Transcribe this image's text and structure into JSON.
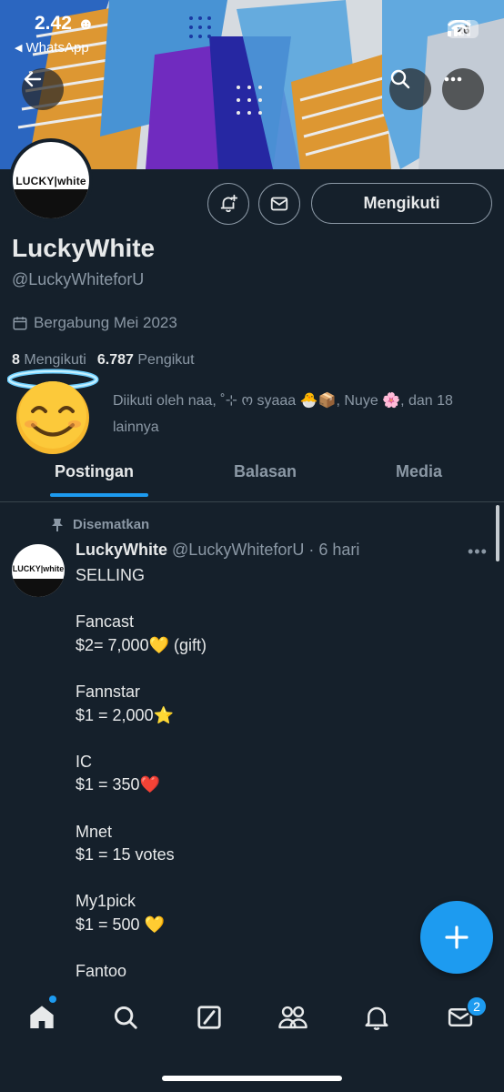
{
  "status_bar": {
    "time": "2.42",
    "back_app": "WhatsApp",
    "battery": "26"
  },
  "profile": {
    "avatar_logo": "LUCKY|white",
    "follow_label": "Mengikuti",
    "display_name": "LuckyWhite",
    "handle": "@LuckyWhiteforU",
    "joined": "Bergabung Mei 2023",
    "following_count": "8",
    "following_label": "Mengikuti",
    "followers_count": "6.787",
    "followers_label": "Pengikut",
    "followed_by": "Diikuti oleh naa, ˚⊹ ო syaaa 🐣📦, Nuye 🌸, dan 18 lainnya"
  },
  "tabs": [
    {
      "label": "Postingan",
      "active": true
    },
    {
      "label": "Balasan",
      "active": false
    },
    {
      "label": "Media",
      "active": false
    }
  ],
  "tweet": {
    "pinned_label": "Disematkan",
    "avatar_logo": "LUCKY|white",
    "name": "LuckyWhite",
    "handle": "@LuckyWhiteforU",
    "time": "· 6 hari",
    "lines": [
      "SELLING",
      "",
      "Fancast",
      "$2= 7,000💛 (gift)",
      "",
      "Fannstar",
      "$1 = 2,000⭐",
      "",
      "IC",
      "$1 = 350❤️",
      "",
      "Mnet",
      "$1 = 15 votes",
      "",
      "My1pick",
      "$1 = 500 💛",
      "",
      "Fantoo"
    ]
  },
  "nav": {
    "items": [
      "home-icon",
      "search-icon",
      "grok-icon",
      "communities-icon",
      "notifications-icon",
      "messages-icon"
    ],
    "messages_badge": "2"
  },
  "colors": {
    "background": "#15202b",
    "accent": "#1d9bf0",
    "muted": "#8b98a5",
    "text": "#e7e9ea"
  }
}
